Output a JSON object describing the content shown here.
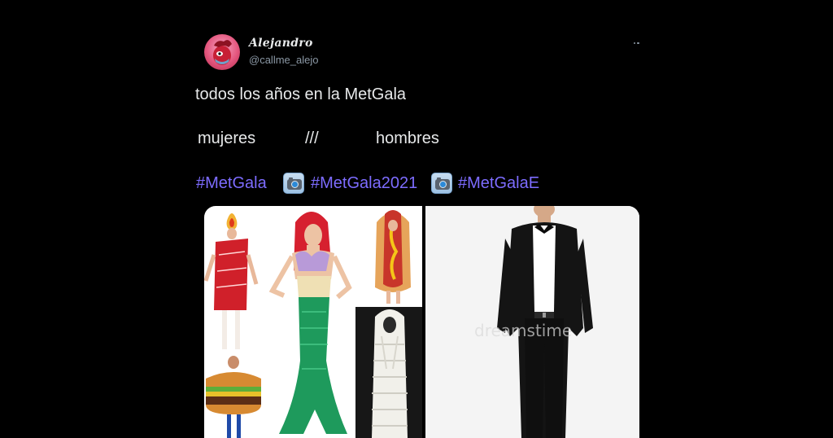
{
  "tweet": {
    "author": {
      "display_name": "Alejandro",
      "handle": "@callme_alejo"
    },
    "menu_icon": "more-horizontal-icon",
    "lines": {
      "line1": "todos los años en la MetGala",
      "line2": {
        "left": "mujeres",
        "sep": "///",
        "right": "hombres"
      }
    },
    "hashtags": [
      "#MetGala",
      "#MetGala2021",
      "#MetGalaE"
    ],
    "emoji": "camera-with-flash-icon",
    "media": {
      "left_panel": "costume-collage",
      "right_panel": "stock-photo-man-in-suit",
      "watermark": "dreamstime"
    }
  },
  "colors": {
    "background": "#000000",
    "text": "#e7e9ea",
    "secondary": "#8b98a5",
    "hashtag": "#7d6cff"
  }
}
